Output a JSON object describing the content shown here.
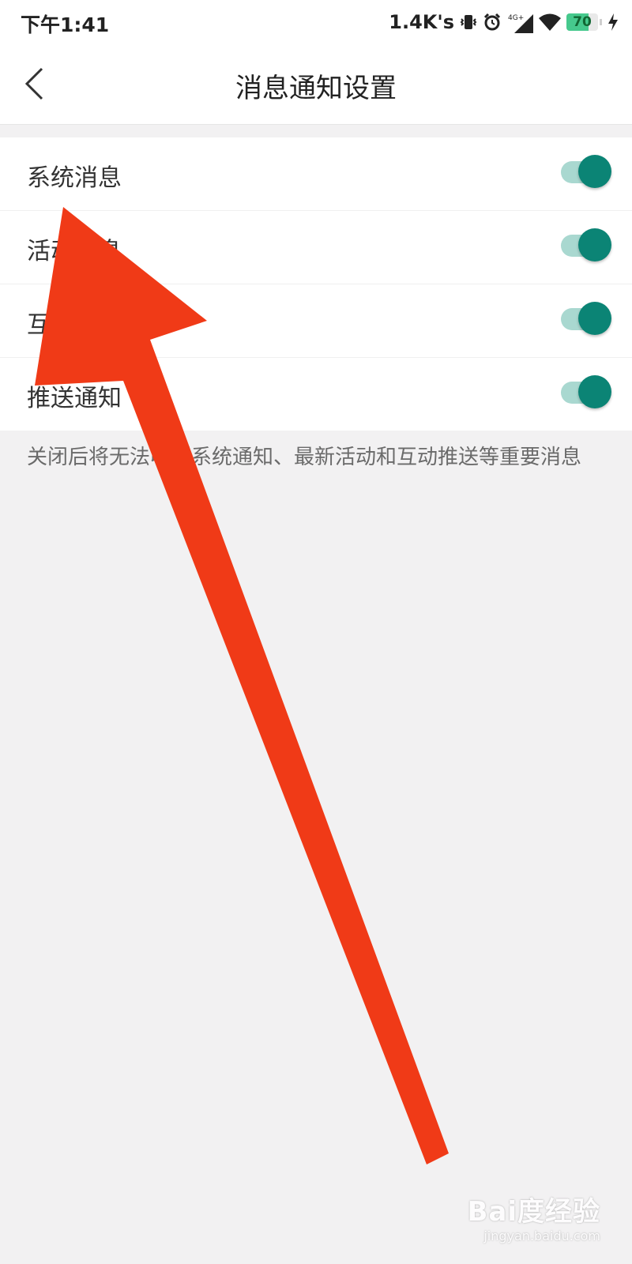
{
  "status_bar": {
    "time": "下午1:41",
    "net_speed": "1.4K's",
    "signal_type": "4G+",
    "battery_level": 70,
    "battery_text": "70",
    "icons": [
      "vibrate-icon",
      "alarm-icon",
      "signal-icon",
      "wifi-icon",
      "battery-icon",
      "charging-icon"
    ]
  },
  "header": {
    "title": "消息通知设置",
    "back_icon": "chevron-left-icon"
  },
  "settings": [
    {
      "label": "系统消息",
      "enabled": true
    },
    {
      "label": "活动消息",
      "enabled": true
    },
    {
      "label": "互动消息",
      "enabled": true
    },
    {
      "label": "推送通知",
      "enabled": true
    }
  ],
  "note": "关闭后将无法收到系统通知、最新活动和互动推送等重要消息",
  "colors": {
    "toggle_on_knob": "#0b8475",
    "toggle_on_track": "#a9d8d0",
    "annotation_arrow": "#f03a17",
    "page_background": "#f2f1f2"
  },
  "watermark": {
    "brand": "Bai度经验",
    "url": "jingyan.baidu.com"
  }
}
